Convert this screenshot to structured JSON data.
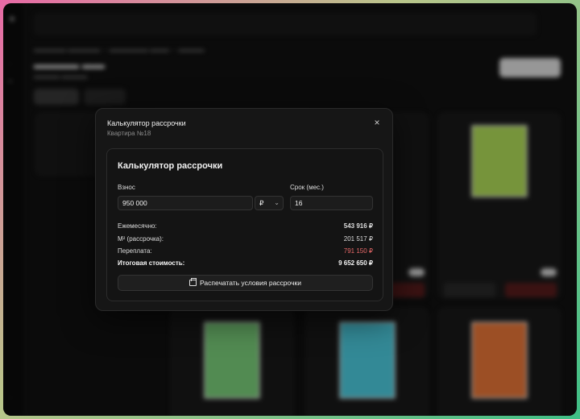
{
  "dialog": {
    "title": "Калькулятор рассрочки",
    "subtitle": "Квартира №18",
    "close_glyph": "×"
  },
  "calculator": {
    "title": "Калькулятор рассрочки",
    "down_payment": {
      "label": "Взнос",
      "value": "950 000",
      "currency": "₽"
    },
    "term": {
      "label": "Срок (мес.)",
      "value": "16"
    },
    "results": [
      {
        "label": "Ежемесячно:",
        "value": "543 916 ₽"
      },
      {
        "label": "М² (рассрочка):",
        "value": "201 517 ₽"
      },
      {
        "label": "Переплата:",
        "value": "791 150 ₽"
      },
      {
        "label": "Итоговая стоимость:",
        "value": "9 652 650 ₽"
      }
    ],
    "print_label": "Распечатать условия рассрочки"
  },
  "icons": {
    "close": "close-icon",
    "chevron": "chevron-down-icon",
    "print": "printer-icon"
  },
  "colors": {
    "overpayment": "#ea6a6a",
    "plan_green": "#b6e35b",
    "plan_cyan": "#4fd3e6",
    "plan_orange": "#f07a3a",
    "plan_mint": "#7ed67e"
  }
}
